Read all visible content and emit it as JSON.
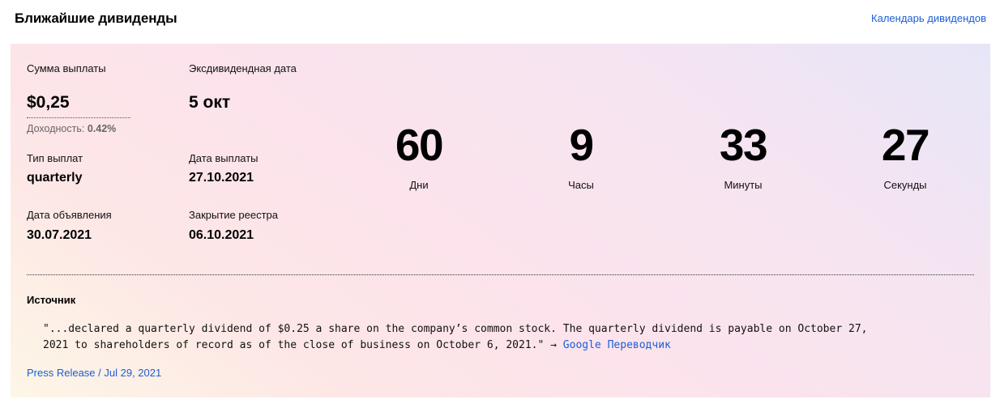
{
  "header": {
    "title": "Ближайшие дивиденды",
    "calendar_link": "Календарь дивидендов"
  },
  "dividend": {
    "amount_label": "Сумма выплаты",
    "amount_value": "$0,25",
    "yield_label": "Доходность:",
    "yield_value": "0.42%",
    "ex_date_label": "Эксдивидендная дата",
    "ex_date_value": "5 окт",
    "type_label": "Тип выплат",
    "type_value": "quarterly",
    "payment_date_label": "Дата выплаты",
    "payment_date_value": "27.10.2021",
    "announce_date_label": "Дата объявления",
    "announce_date_value": "30.07.2021",
    "record_date_label": "Закрытие реестра",
    "record_date_value": "06.10.2021"
  },
  "countdown": [
    {
      "value": "60",
      "label": "Дни"
    },
    {
      "value": "9",
      "label": "Часы"
    },
    {
      "value": "33",
      "label": "Минуты"
    },
    {
      "value": "27",
      "label": "Секунды"
    }
  ],
  "source": {
    "title": "Источник",
    "quote": "\"...declared a quarterly dividend of $0.25 a share on the company’s common stock. The quarterly dividend is payable on October 27,\n2021 to shareholders of record as of the close of business on October 6, 2021.\" → ",
    "translate_link": "Google Переводчик",
    "press_release": "Press Release / Jul 29, 2021"
  }
}
